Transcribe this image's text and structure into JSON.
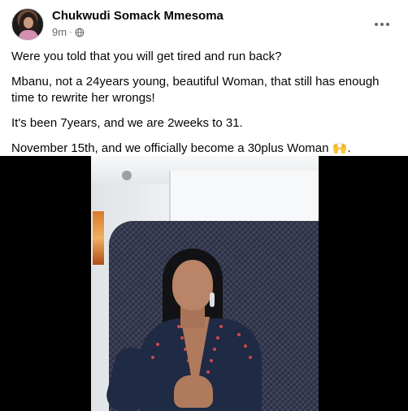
{
  "post": {
    "author": "Chukwudi Somack Mmesoma",
    "time": "9m",
    "separator": "·",
    "privacy_icon": "globe-icon",
    "more_icon": "more-options-icon",
    "paragraphs": [
      "Were you told that you will get tired and run back?",
      "Mbanu, not a 24years young, beautiful Woman, that still has enough time to rewrite her wrongs!",
      "It's been 7years, and we are 2weeks to 31.",
      "November 15th, and we officially become a 30plus Woman 🙌."
    ]
  },
  "colors": {
    "text_primary": "#050505",
    "text_secondary": "#65676b",
    "video_background": "#000000"
  }
}
